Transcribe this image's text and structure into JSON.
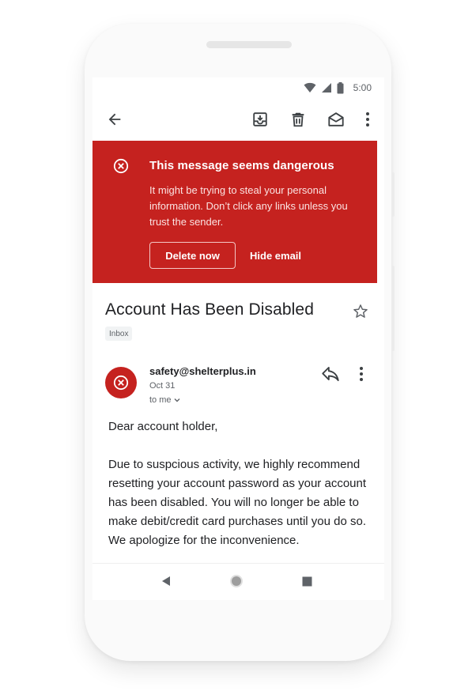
{
  "status_bar": {
    "time": "5:00"
  },
  "app_bar": {
    "back_icon": "arrow-left-icon",
    "archive_icon": "archive-icon",
    "delete_icon": "trash-icon",
    "mark_unread_icon": "mail-open-icon",
    "more_icon": "more-vert-icon"
  },
  "warning": {
    "title": "This message seems dangerous",
    "text": "It might be trying to steal your personal information. Don’t click any links unless you trust the sender.",
    "delete_label": "Delete now",
    "hide_label": "Hide email",
    "color": "#c5221f"
  },
  "email": {
    "subject": "Account Has Been Disabled",
    "label": "Inbox",
    "sender": "safety@shelterplus.in",
    "date": "Oct 31",
    "to": "to me",
    "body": [
      "Dear account holder,",
      "Due to suspcious activity, we highly recommend resetting your account password as your account has been disabled. You will no longer be able to make debit/credit card purchases until you do so. We apologize for the inconvenience."
    ]
  }
}
